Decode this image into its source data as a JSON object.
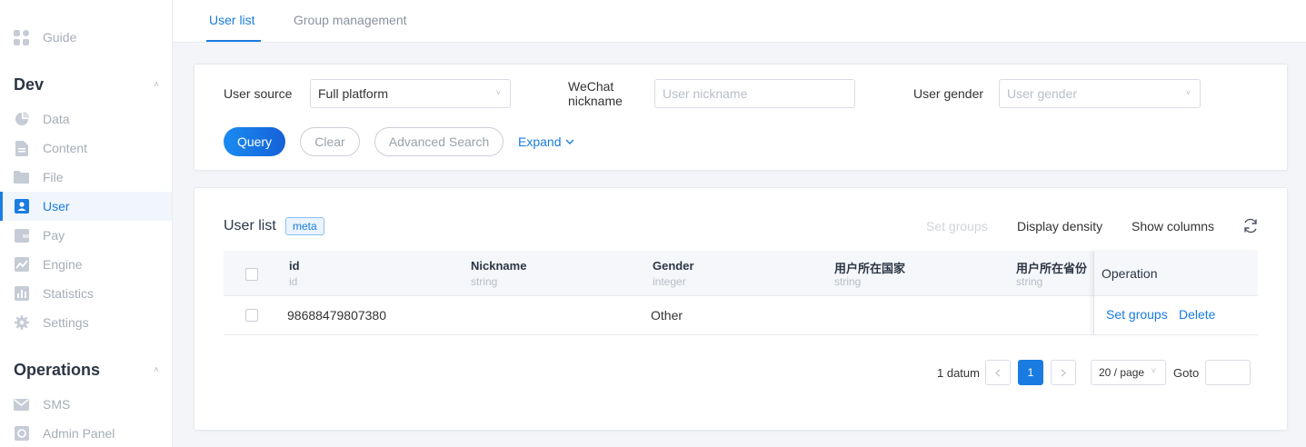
{
  "sidebar": {
    "guide": "Guide",
    "sections": [
      {
        "title": "Dev"
      },
      {
        "title": "Operations"
      }
    ],
    "dev_items": [
      "Data",
      "Content",
      "File",
      "User",
      "Pay",
      "Engine",
      "Statistics",
      "Settings"
    ],
    "ops_items": [
      "SMS",
      "Admin Panel"
    ],
    "active_item": "User",
    "accent_color": "#1a7ce0"
  },
  "tabs": {
    "user_list": "User list",
    "group_management": "Group management",
    "active": "User list"
  },
  "filters": {
    "user_source_label": "User source",
    "user_source_value": "Full platform",
    "wechat_label_line1": "WeChat",
    "wechat_label_line2": "nickname",
    "wechat_placeholder": "User nickname",
    "gender_label": "User gender",
    "gender_placeholder": "User gender"
  },
  "actions": {
    "query": "Query",
    "clear": "Clear",
    "advanced_search": "Advanced Search",
    "expand": "Expand"
  },
  "list": {
    "title": "User list",
    "badge": "meta",
    "set_groups": "Set groups",
    "display_density": "Display density",
    "show_columns": "Show columns"
  },
  "table": {
    "columns": [
      {
        "name": "id",
        "type": "id"
      },
      {
        "name": "Nickname",
        "type": "string"
      },
      {
        "name": "Gender",
        "type": "integer"
      },
      {
        "name": "用户所在国家",
        "type": "string"
      },
      {
        "name": "用户所在省份",
        "type": "string"
      }
    ],
    "operation_header": "Operation",
    "rows": [
      {
        "id": "98688479807380",
        "nickname": "",
        "gender": "Other",
        "country": "",
        "province": "",
        "op_set_groups": "Set groups",
        "op_delete": "Delete"
      }
    ]
  },
  "pagination": {
    "total": "1 datum",
    "current_page": "1",
    "page_size": "20 / page",
    "goto_label": "Goto"
  }
}
